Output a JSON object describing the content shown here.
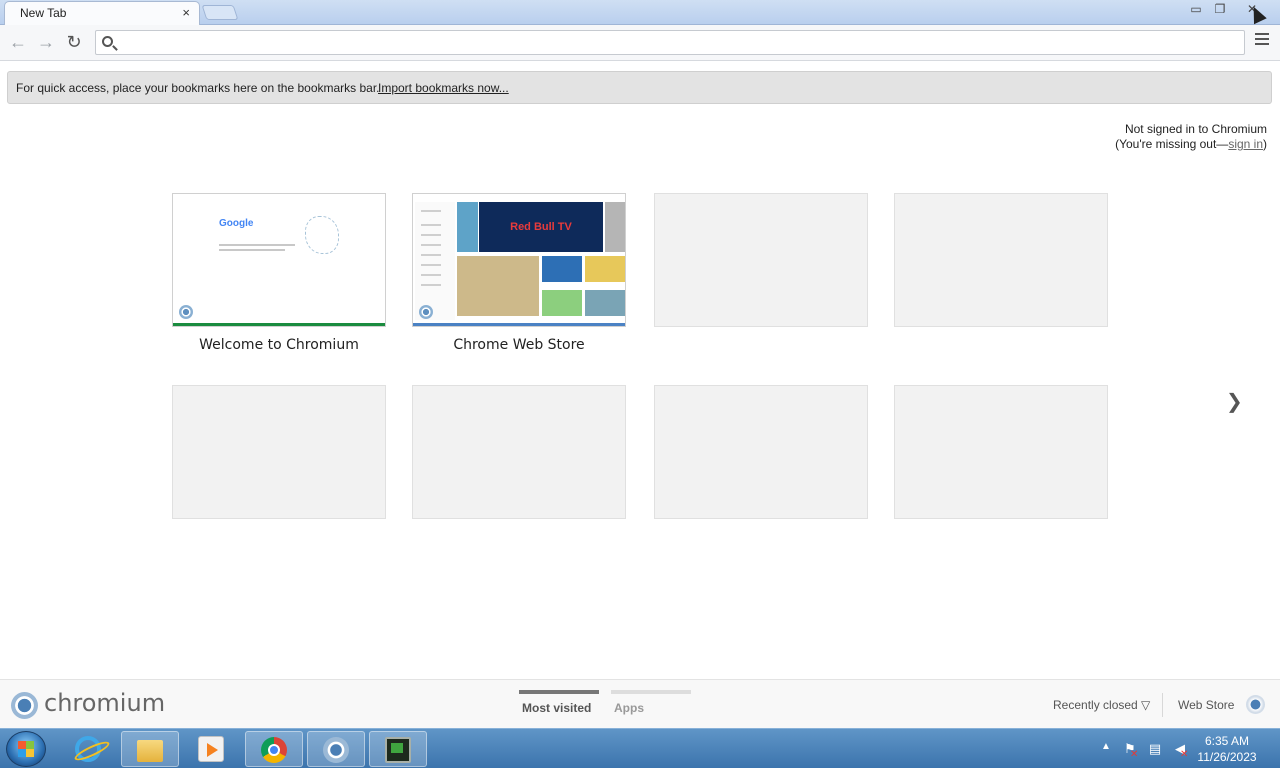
{
  "tab": {
    "title": "New Tab",
    "close_label": "×"
  },
  "window_controls": {
    "minimize": "▭",
    "maximize": "❐",
    "close": "✕"
  },
  "toolbar": {
    "back_label": "←",
    "forward_label": "→",
    "reload_label": "↻",
    "omnibox_value": "",
    "star_label": "☆"
  },
  "bookmarks_bar": {
    "message": "For quick access, place your bookmarks here on the bookmarks bar.",
    "import_link": "Import bookmarks now..."
  },
  "signin": {
    "line1": "Not signed in to Chromium",
    "line2_prefix": "(You're missing out—",
    "link": "sign in",
    "line2_suffix": ")"
  },
  "most_visited": [
    {
      "title": "Welcome to Chromium"
    },
    {
      "title": "Chrome Web Store"
    },
    {
      "title": ""
    },
    {
      "title": ""
    },
    {
      "title": ""
    },
    {
      "title": ""
    },
    {
      "title": ""
    },
    {
      "title": ""
    }
  ],
  "welcome_thumb": {
    "logo_text": "Google"
  },
  "webstore_thumb": {
    "featured": "Red Bull TV"
  },
  "pager_label": "❯",
  "footer": {
    "brand": "chromium",
    "tabs": [
      {
        "label": "Most visited",
        "active": true
      },
      {
        "label": "Apps",
        "active": false
      }
    ],
    "recently_closed": "Recently closed ▽",
    "web_store": "Web Store"
  },
  "taskbar": {
    "apps": [
      "Internet Explorer",
      "Windows Explorer",
      "Windows Media Player",
      "Google Chrome",
      "Chromium",
      "Terminal"
    ],
    "tray_arrow": "▲",
    "clock_time": "6:35 AM",
    "clock_date": "11/26/2023"
  },
  "colors": {
    "taskbar": "#3c74ad",
    "tab_accent_green": "#1b8c3f",
    "tab_accent_blue": "#4b82c4"
  }
}
